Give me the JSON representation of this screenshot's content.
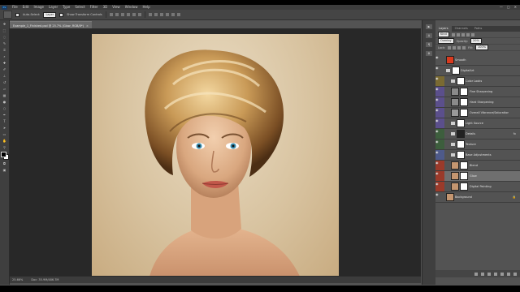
{
  "menu": [
    "File",
    "Edit",
    "Image",
    "Layer",
    "Type",
    "Select",
    "Filter",
    "3D",
    "View",
    "Window",
    "Help"
  ],
  "window_controls": [
    "—",
    "▢",
    "✕"
  ],
  "options": {
    "auto_select_label": "Auto-Select:",
    "auto_select_value": "Layer",
    "transform_label": "Show Transform Controls"
  },
  "document_tab": {
    "title": "Example_1_Finished.psd @ 25.7% (Glow, RGB/8*)",
    "close": "×"
  },
  "status": {
    "zoom": "25.66%",
    "doc": "Doc: 35.9M/486.7M"
  },
  "dock_icons": [
    "▶",
    "A",
    "¶",
    "⚙"
  ],
  "layers_panel": {
    "tabs": [
      "Layers",
      "Channels",
      "Paths"
    ],
    "active_tab": "Layers",
    "filter_kind": "Kind",
    "blend_mode": "Overlay",
    "opacity_label": "Opacity:",
    "opacity_value": "20%",
    "lock_label": "Lock:",
    "fill_label": "Fill:",
    "fill_value": "100%",
    "layers": [
      {
        "name": "Smooth",
        "type": "smart",
        "indent": 0,
        "color": "#535353",
        "thumb": "#d93a1e"
      },
      {
        "name": "DigitalArt",
        "type": "group",
        "indent": 0,
        "color": "#535353",
        "thumb": "#ffffff"
      },
      {
        "name": "Color Looks",
        "type": "group",
        "indent": 1,
        "color": "#7a6a32",
        "thumb": "#ffffff"
      },
      {
        "name": "Fine Sharpening",
        "type": "layer",
        "indent": 1,
        "color": "#5b4f8c",
        "thumb": "#8a8a8a"
      },
      {
        "name": "Hard Sharpening",
        "type": "layer",
        "indent": 1,
        "color": "#5b4f8c",
        "thumb": "#8a8a8a"
      },
      {
        "name": "Overall Vibrance/Saturation",
        "type": "adjust",
        "indent": 1,
        "color": "#5b4f8c",
        "thumb": "#9a9a9a"
      },
      {
        "name": "Light Source",
        "type": "group",
        "indent": 1,
        "color": "#5b4f8c",
        "thumb": "#ffffff"
      },
      {
        "name": "Details",
        "type": "group",
        "indent": 1,
        "color": "#3d5e3d",
        "thumb": "#222222"
      },
      {
        "name": "Texture",
        "type": "group",
        "indent": 1,
        "color": "#3d5e3d",
        "thumb": "#ffffff"
      },
      {
        "name": "Base Adjustments",
        "type": "group",
        "indent": 1,
        "color": "#4e5a8a",
        "thumb": "#ffffff"
      },
      {
        "name": "Blend",
        "type": "layer",
        "indent": 1,
        "color": "#9a3a2a",
        "thumb": "#c49670"
      },
      {
        "name": "Glow",
        "type": "layer",
        "indent": 1,
        "color": "#9a3a2a",
        "thumb": "#c49670"
      },
      {
        "name": "Digital Painting",
        "type": "layer",
        "indent": 1,
        "color": "#9a3a2a",
        "thumb": "#c49670"
      },
      {
        "name": "Background",
        "type": "background",
        "indent": 0,
        "color": "#535353",
        "thumb": "#c49670"
      }
    ],
    "selected": "Glow"
  }
}
